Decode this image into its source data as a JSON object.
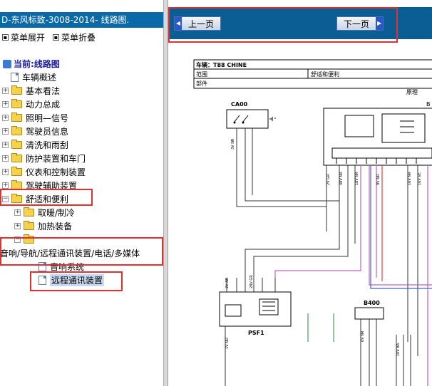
{
  "window_title": "D-东风标致-3008-2014- 线路图.",
  "menu": {
    "expand": "菜单展开",
    "collapse": "菜单折叠"
  },
  "current": "当前:线路图",
  "tree": [
    {
      "label": "车辆概述",
      "type": "page"
    },
    {
      "label": "基本看法",
      "type": "folder"
    },
    {
      "label": "动力总成",
      "type": "folder"
    },
    {
      "label": "照明—信号",
      "type": "folder"
    },
    {
      "label": "驾驶员信息",
      "type": "folder"
    },
    {
      "label": "清洗和雨刮",
      "type": "folder"
    },
    {
      "label": "防护装置和车门",
      "type": "folder"
    },
    {
      "label": "仪表和控制装置",
      "type": "folder"
    },
    {
      "label": "驾驶辅助装置",
      "type": "folder"
    },
    {
      "label": "舒适和便利",
      "type": "folder-open"
    },
    {
      "label": "取暖/制冷",
      "type": "folder"
    },
    {
      "label": "加热装备",
      "type": "folder"
    },
    {
      "label": "音响/导航/远程通讯装置/电话/多媒体",
      "type": "folder-open"
    },
    {
      "label": "音响系统",
      "type": "page"
    },
    {
      "label": "远程通讯装置",
      "type": "page"
    }
  ],
  "nav": {
    "prev": "上一页",
    "next": "下一页"
  },
  "diagram": {
    "header_vehicle": "车辆：T88 CHINE",
    "header_row2_left": "范围",
    "header_row2_right": "舒适和便利",
    "header_row3": "部件",
    "section_label": "原理",
    "section_label_right": "B",
    "components": {
      "ca00": "CA00",
      "psf1": "PSF1",
      "b400": "B400"
    },
    "wire_labels": [
      "2V GR",
      "48V NR",
      "16V NR",
      "18V NR",
      "3V NR",
      "28V GR",
      "2V NR",
      "6V NR",
      "10V BA",
      "1V ND",
      "16V VE",
      "9V NR"
    ]
  },
  "colors": {
    "title_bg": "#0a6aa8",
    "nav_bg": "#0b5e94",
    "highlight": "#e03030"
  }
}
